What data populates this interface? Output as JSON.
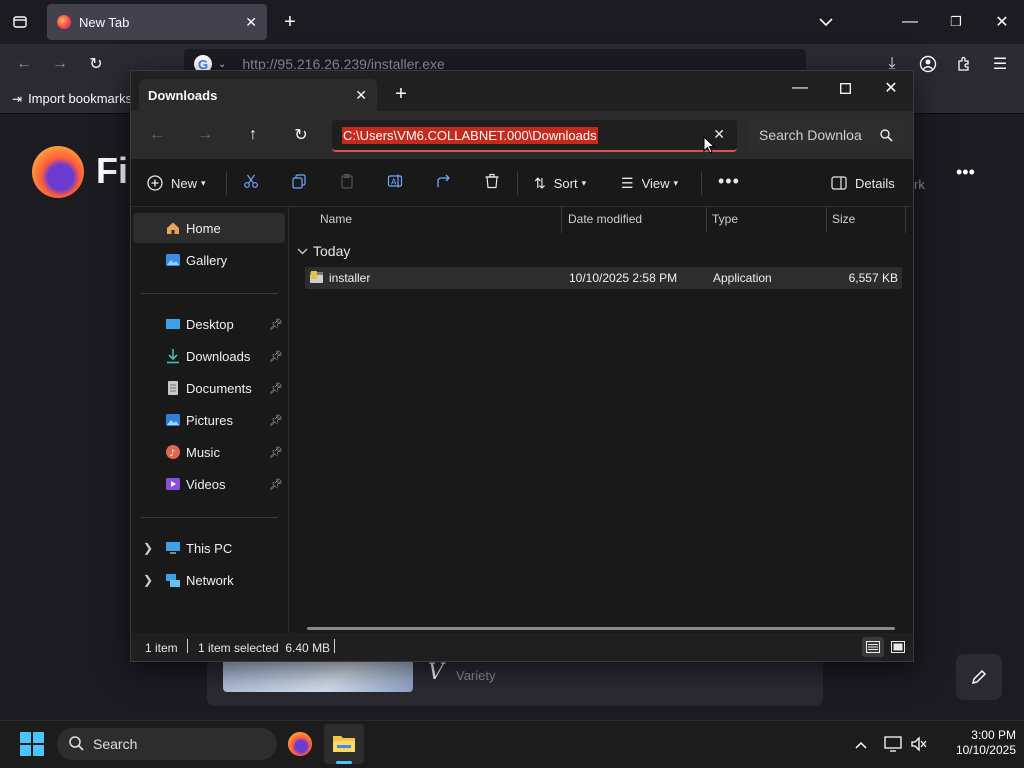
{
  "firefox": {
    "tab_title": "New Tab",
    "url": "http://95.216.26.239/installer.exe",
    "bookmarks_import": "Import bookmarks",
    "brand_partial": "Fi",
    "card_caption": "Variety",
    "card_logo_letter": "V",
    "right_partial_label": "rk"
  },
  "explorer": {
    "tab_title": "Downloads",
    "address_path": "C:\\Users\\VM6.COLLABNET.000\\Downloads",
    "search_placeholder": "Search Downloa",
    "toolbar": {
      "new_label": "New",
      "sort_label": "Sort",
      "view_label": "View",
      "details_label": "Details"
    },
    "nav": {
      "home": "Home",
      "gallery": "Gallery",
      "desktop": "Desktop",
      "downloads": "Downloads",
      "documents": "Documents",
      "pictures": "Pictures",
      "music": "Music",
      "videos": "Videos",
      "this_pc": "This PC",
      "network": "Network"
    },
    "columns": {
      "name": "Name",
      "date_modified": "Date modified",
      "type": "Type",
      "size": "Size"
    },
    "group_label": "Today",
    "files": [
      {
        "name": "installer",
        "date": "10/10/2025 2:58 PM",
        "type": "Application",
        "size": "6,557 KB"
      }
    ],
    "status": {
      "count": "1 item",
      "selected": "1 item selected  6.40 MB"
    }
  },
  "taskbar": {
    "search_label": "Search",
    "time": "3:00 PM",
    "date": "10/10/2025"
  },
  "colors": {
    "explorer_bg": "#191919",
    "selection_red": "#c42b1c",
    "firefox_bg": "#1c1b22"
  }
}
